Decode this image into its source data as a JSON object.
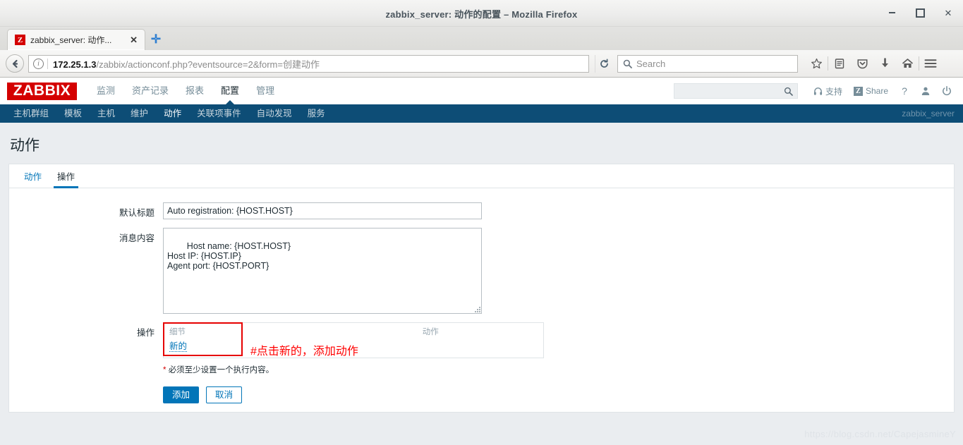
{
  "window": {
    "title": "zabbix_server: 动作的配置 – Mozilla Firefox",
    "minimize_label": "",
    "maximize_label": "",
    "close_label": "✕"
  },
  "browser": {
    "tab": {
      "favicon_letter": "Z",
      "title": "zabbix_server: 动作...",
      "close_label": "✕"
    },
    "new_tab_label": "✛",
    "back_label": "❮",
    "identity_icon": "i",
    "url_host": "172.25.1.3",
    "url_path": "/zabbix/actionconf.php?eventsource=2&form=创建动作",
    "reload_label": "⟳",
    "search": {
      "placeholder": "Search",
      "value": ""
    },
    "toolbar_icons": [
      "bookmark-star-icon",
      "reader-list-icon",
      "pocket-icon",
      "downloads-icon",
      "home-icon",
      "menu-icon"
    ]
  },
  "zabbix": {
    "logo": "ZABBIX",
    "main_nav": [
      {
        "label": "监测",
        "active": false
      },
      {
        "label": "资产记录",
        "active": false
      },
      {
        "label": "报表",
        "active": false
      },
      {
        "label": "配置",
        "active": true
      },
      {
        "label": "管理",
        "active": false
      }
    ],
    "header_right": {
      "search_value": "",
      "support_label": "支持",
      "share_label": "Share",
      "share_badge": "Z",
      "help_label": "?",
      "user_icon": "user-icon",
      "signout_icon": "power-icon"
    },
    "sub_nav": [
      {
        "label": "主机群组",
        "active": false
      },
      {
        "label": "模板",
        "active": false
      },
      {
        "label": "主机",
        "active": false
      },
      {
        "label": "维护",
        "active": false
      },
      {
        "label": "动作",
        "active": true
      },
      {
        "label": "关联项事件",
        "active": false
      },
      {
        "label": "自动发现",
        "active": false
      },
      {
        "label": "服务",
        "active": false
      }
    ],
    "server_name": "zabbix_server",
    "page_title": "动作",
    "tabs": [
      {
        "label": "动作",
        "active": false
      },
      {
        "label": "操作",
        "active": true
      }
    ],
    "form": {
      "default_title": {
        "label": "默认标题",
        "value": "Auto registration: {HOST.HOST}"
      },
      "message_body": {
        "label": "消息内容",
        "value": "Host name: {HOST.HOST}\nHost IP: {HOST.IP}\nAgent port: {HOST.PORT}"
      },
      "operations": {
        "label": "操作",
        "columns": [
          "细节",
          "动作"
        ],
        "new_link": "新的",
        "annotation": "#点击新的，添加动作",
        "required_note": "必须至少设置一个执行内容。",
        "required_star": "*"
      },
      "buttons": {
        "add": "添加",
        "cancel": "取消"
      }
    }
  },
  "watermark": "https://blog.csdn.net/CapejasmineY",
  "colors": {
    "zabbix_red": "#d40000",
    "zabbix_navy": "#0d4d76",
    "accent_blue": "#0275b8",
    "annotation_red": "#ff0000"
  }
}
